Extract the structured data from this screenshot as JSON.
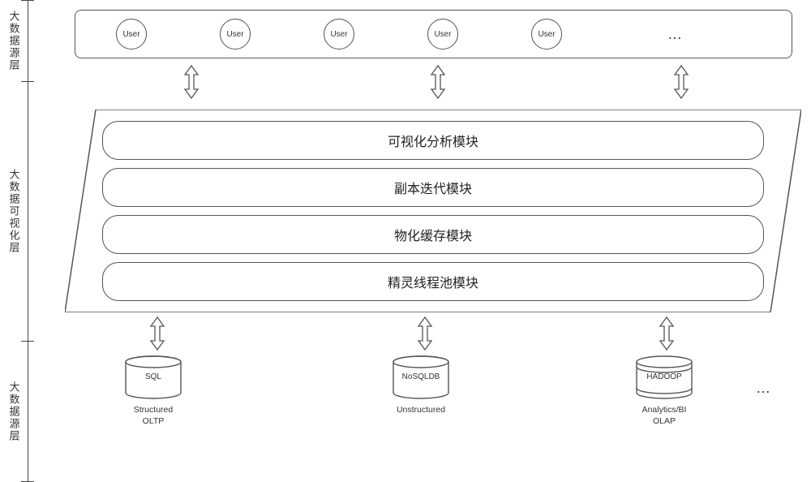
{
  "layers": {
    "top_label": "大数据源层",
    "mid_label": "大数据可视化层",
    "bot_label": "大数据源层"
  },
  "users": {
    "label": "User",
    "ellipsis": "…"
  },
  "modules": {
    "m1": "可视化分析模块",
    "m2": "副本迭代模块",
    "m3": "物化缓存模块",
    "m4": "精灵线程池模块"
  },
  "datasources": {
    "d1": {
      "name": "SQL",
      "caption_l1": "Structured",
      "caption_l2": "OLTP"
    },
    "d2": {
      "name": "NoSQLDB",
      "caption_l1": "Unstructured",
      "caption_l2": ""
    },
    "d3": {
      "name": "HADOOP",
      "caption_l1": "Analytics/BI",
      "caption_l2": "OLAP"
    },
    "ellipsis": "…"
  },
  "chart_data": {
    "type": "table",
    "title": "Big-data visualization layered architecture",
    "layers": [
      {
        "name": "大数据源层 (top)",
        "nodes": [
          "User",
          "User",
          "User",
          "User",
          "User",
          "…"
        ]
      },
      {
        "name": "大数据可视化层",
        "nodes": [
          "可视化分析模块",
          "副本迭代模块",
          "物化缓存模块",
          "精灵线程池模块"
        ]
      },
      {
        "name": "大数据源层 (bottom)",
        "nodes": [
          "SQL (Structured / OLTP)",
          "NoSQLDB (Unstructured)",
          "HADOOP (Analytics/BI / OLAP)",
          "…"
        ]
      }
    ],
    "connections": [
      {
        "from": "top layer",
        "to": "middle layer",
        "type": "bidirectional",
        "count": 3
      },
      {
        "from": "middle layer",
        "to": "bottom layer",
        "type": "bidirectional",
        "count": 3
      }
    ]
  }
}
